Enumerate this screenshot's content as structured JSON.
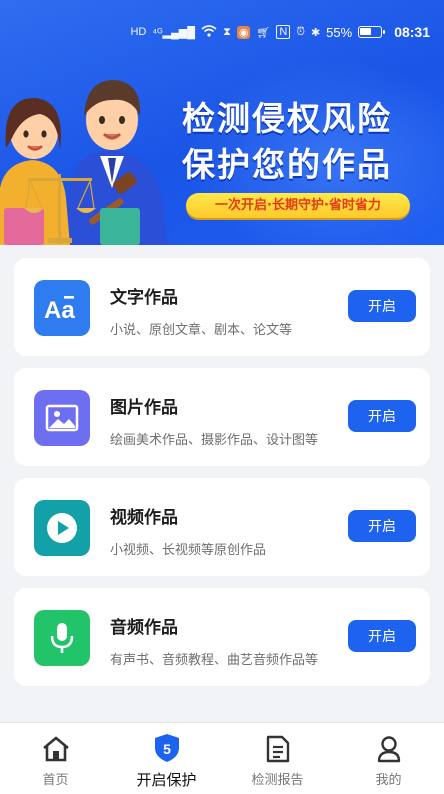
{
  "status_bar": {
    "left_icons": [
      "hd-icon",
      "signal-4g-icon",
      "wifi-icon",
      "hourglass-icon",
      "app-icon",
      "cart-icon",
      "nfc-icon",
      "alarm-icon",
      "bluetooth-icon"
    ],
    "battery": "55%",
    "time": "08:31"
  },
  "hero": {
    "title_line1": "检测侵权风险",
    "title_line2": "保护您的作品",
    "tagline": "一次开启·长期守护·省时省力"
  },
  "works": [
    {
      "title": "文字作品",
      "desc": "小说、原创文章、剧本、论文等",
      "button": "开启",
      "icon": "text-aa-icon",
      "color": "#2f7cf0"
    },
    {
      "title": "图片作品",
      "desc": "绘画美术作品、摄影作品、设计图等",
      "button": "开启",
      "icon": "image-icon",
      "color": "#6e6ff0"
    },
    {
      "title": "视频作品",
      "desc": "小视频、长视频等原创作品",
      "button": "开启",
      "icon": "play-icon",
      "color": "#14a0a8"
    },
    {
      "title": "音频作品",
      "desc": "有声书、音频教程、曲艺音频作品等",
      "button": "开启",
      "icon": "microphone-icon",
      "color": "#22c46a"
    }
  ],
  "bottom_nav": [
    {
      "label": "首页",
      "icon": "home-icon"
    },
    {
      "label": "开启保护",
      "icon": "shield-icon",
      "active": true
    },
    {
      "label": "检测报告",
      "icon": "report-icon"
    },
    {
      "label": "我的",
      "icon": "profile-icon"
    }
  ],
  "colors": {
    "primary": "#1e62f0",
    "hero_bg": "#1a55e6",
    "tag_bg": "#ffd83a",
    "tag_text": "#e23b16"
  }
}
